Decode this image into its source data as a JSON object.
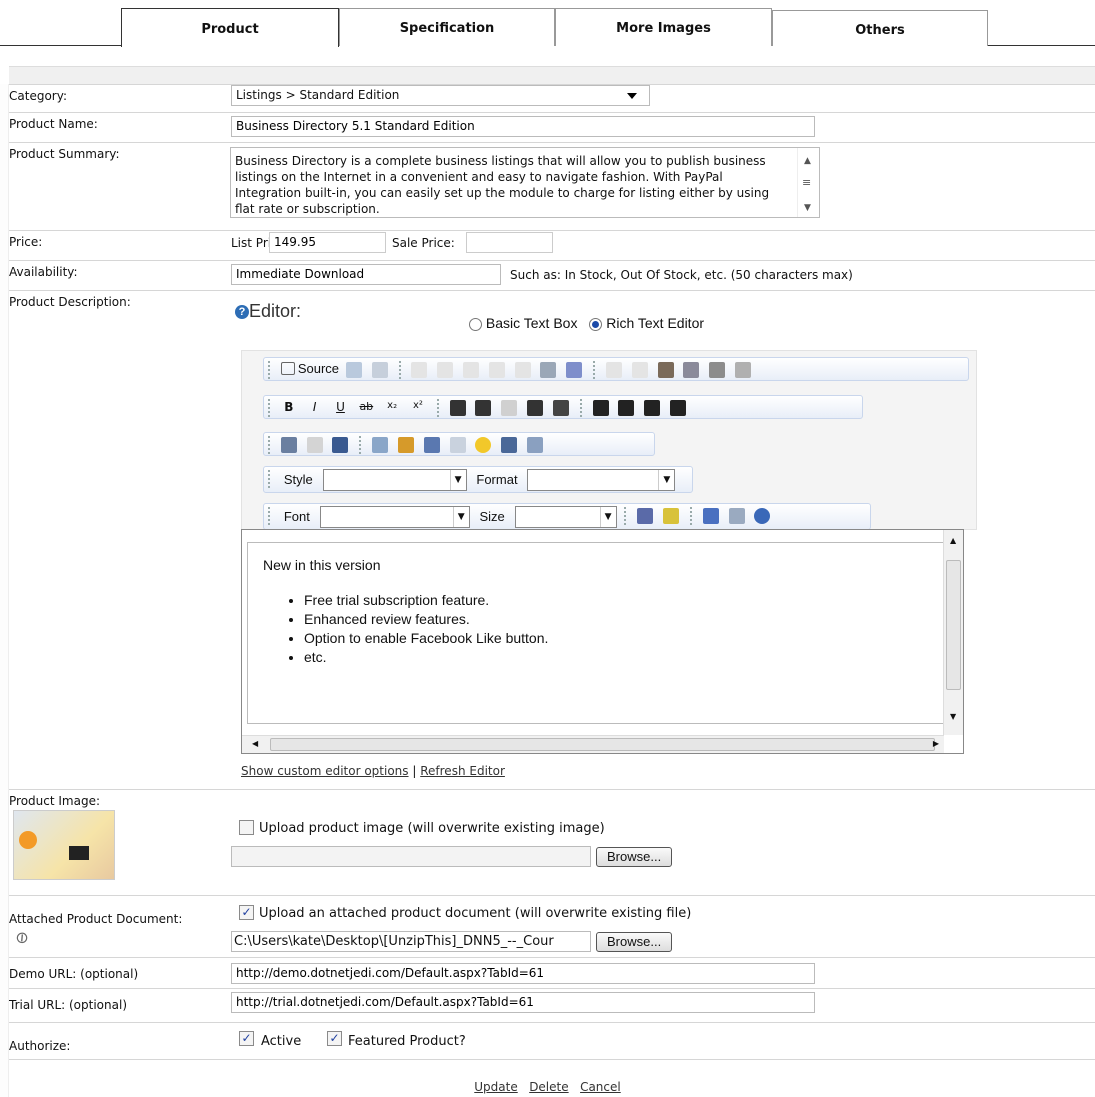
{
  "tabs": [
    "Product",
    "Specification",
    "More Images",
    "Others"
  ],
  "labels": {
    "category": "Category:",
    "product_name": "Product Name:",
    "product_summary": "Product Summary:",
    "price": "Price:",
    "availability": "Availability:",
    "product_description": "Product Description:",
    "product_image": "Product Image:",
    "attached_document": "Attached Product Document:",
    "demo_url": "Demo URL: (optional)",
    "trial_url": "Trial URL: (optional)",
    "authorize": "Authorize:"
  },
  "category_value": "Listings > Standard Edition",
  "product_name_value": "Business Directory 5.1 Standard Edition",
  "product_summary_value": "Business Directory is a complete business listings that will allow you to publish business listings on the Internet in a convenient and easy to navigate fashion. With PayPal Integration built-in, you can easily set up the module to charge for listing either by using flat rate or subscription.",
  "price": {
    "list_label": "List Price:",
    "list_value": "149.95",
    "sale_label": "Sale Price:",
    "sale_value": ""
  },
  "availability_value": "Immediate Download",
  "availability_hint": "Such as: In Stock, Out Of Stock, etc. (50 characters max)",
  "editor": {
    "label": "Editor:",
    "basic_option": "Basic Text Box",
    "rich_option": "Rich Text Editor",
    "source_label": "Source",
    "style_label": "Style",
    "format_label": "Format",
    "font_label": "Font",
    "size_label": "Size",
    "content_heading": "New in this version",
    "content_items": [
      "Free trial subscription feature.",
      "Enhanced review features.",
      "Option to enable Facebook Like button.",
      "etc."
    ],
    "show_options_link": "Show custom editor options",
    "separator": "|",
    "refresh_link": "Refresh Editor"
  },
  "upload_image_label": "Upload product image (will overwrite existing image)",
  "browse_label": "Browse...",
  "upload_document_label": "Upload an attached product document (will overwrite existing file)",
  "document_path": "C:\\Users\\kate\\Desktop\\[UnzipThis]_DNN5_--_Cour",
  "demo_url_value": "http://demo.dotnetjedi.com/Default.aspx?TabId=61",
  "trial_url_value": "http://trial.dotnetjedi.com/Default.aspx?TabId=61",
  "authorize": {
    "active_label": "Active",
    "featured_label": "Featured Product?"
  },
  "actions": {
    "update": "Update",
    "delete": "Delete",
    "cancel": "Cancel"
  }
}
